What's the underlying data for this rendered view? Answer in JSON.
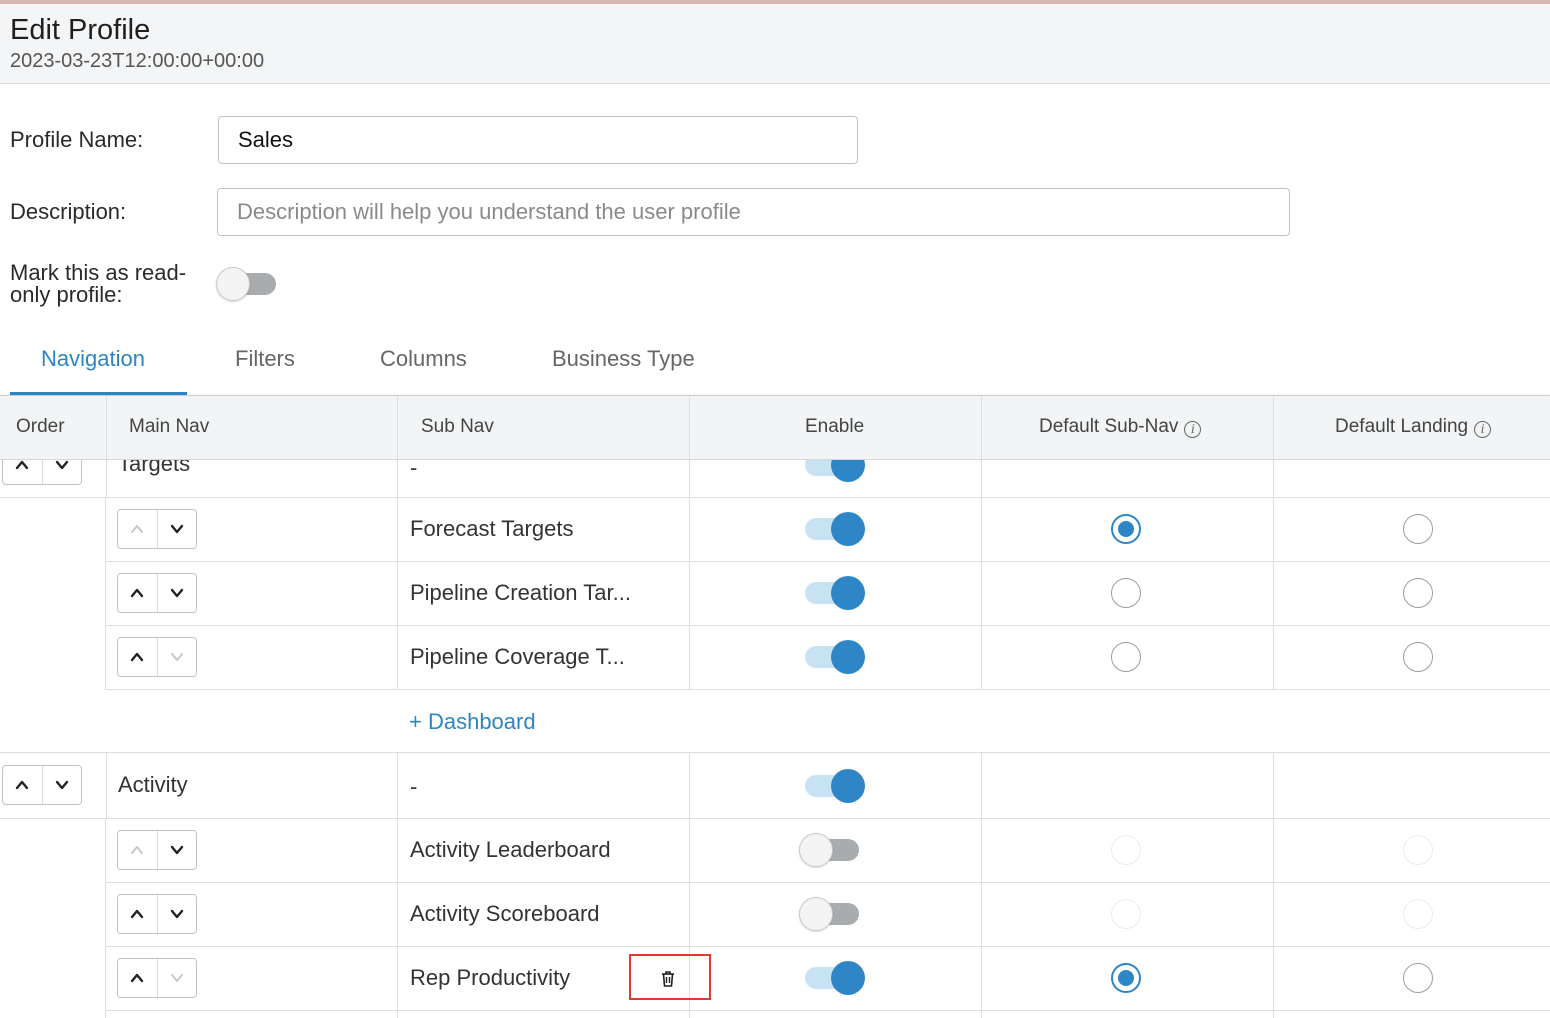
{
  "header": {
    "title": "Edit Profile",
    "subtitle": "2023-03-23T12:00:00+00:00"
  },
  "form": {
    "profile_name_label": "Profile Name:",
    "profile_name_value": "Sales",
    "description_label": "Description:",
    "description_placeholder": "Description will help you understand the user profile",
    "readonly_label_line1": "Mark this as read-",
    "readonly_label_line2": "only profile:",
    "readonly_enabled": false
  },
  "tabs": [
    {
      "label": "Navigation",
      "active": true
    },
    {
      "label": "Filters",
      "active": false
    },
    {
      "label": "Columns",
      "active": false
    },
    {
      "label": "Business Type",
      "active": false
    }
  ],
  "table": {
    "columns": [
      "Order",
      "Main Nav",
      "Sub Nav",
      "Enable",
      "Default Sub-Nav",
      "Default Landing"
    ],
    "groups": [
      {
        "main_nav": "Targets",
        "sub_nav": "-",
        "enabled": true,
        "sub_rows": [
          {
            "label": "Forecast Targets",
            "enabled": true,
            "default_sub_nav": true,
            "default_landing": false,
            "up_disabled": true,
            "down_disabled": false
          },
          {
            "label": "Pipeline Creation Tar...",
            "enabled": true,
            "default_sub_nav": false,
            "default_landing": false,
            "up_disabled": false,
            "down_disabled": false
          },
          {
            "label": "Pipeline Coverage T...",
            "enabled": true,
            "default_sub_nav": false,
            "default_landing": false,
            "up_disabled": false,
            "down_disabled": true
          }
        ],
        "add_link": "+ Dashboard"
      },
      {
        "main_nav": "Activity",
        "sub_nav": "-",
        "enabled": true,
        "sub_rows": [
          {
            "label": "Activity Leaderboard",
            "enabled": false,
            "default_sub_nav": false,
            "default_landing": false,
            "up_disabled": true,
            "down_disabled": false
          },
          {
            "label": "Activity Scoreboard",
            "enabled": false,
            "default_sub_nav": false,
            "default_landing": false,
            "up_disabled": false,
            "down_disabled": false
          },
          {
            "label": "Rep Productivity",
            "enabled": true,
            "default_sub_nav": true,
            "default_landing": false,
            "up_disabled": false,
            "down_disabled": true
          }
        ]
      }
    ]
  },
  "icons": {
    "info": "info-circle-icon",
    "up": "chevron-up-icon",
    "down": "chevron-down-icon",
    "delete": "trash-icon"
  },
  "colors": {
    "accent": "#2c86c4",
    "highlight_border": "#e03a2e"
  }
}
